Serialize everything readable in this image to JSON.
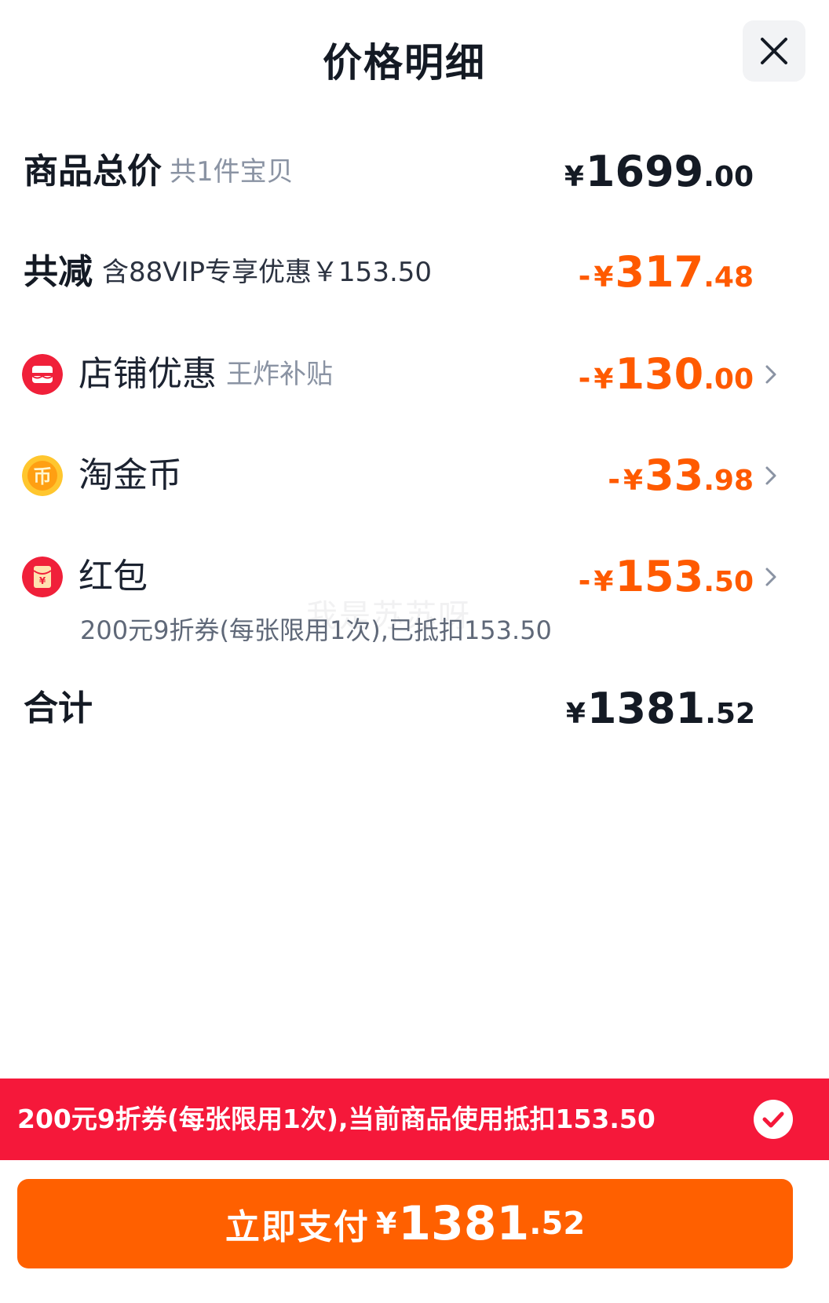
{
  "header": {
    "title": "价格明细",
    "close_icon": "close-icon"
  },
  "rows": {
    "total_goods": {
      "label": "商品总价",
      "sub": "共1件宝贝",
      "currency": "¥",
      "amount_int": "1699",
      "amount_dec": ".00"
    },
    "total_discount": {
      "label": "共减",
      "sub": "含88VIP专享优惠￥153.50",
      "sign": "-",
      "currency": "¥",
      "amount_int": "317",
      "amount_dec": ".48"
    },
    "shop_discount": {
      "icon": "shop-icon",
      "label": "店铺优惠",
      "sub": "王炸补贴",
      "sign": "-",
      "currency": "¥",
      "amount_int": "130",
      "amount_dec": ".00"
    },
    "tao_coin": {
      "icon": "coin-icon",
      "icon_glyph": "币",
      "label": "淘金币",
      "sign": "-",
      "currency": "¥",
      "amount_int": "33",
      "amount_dec": ".98"
    },
    "red_packet": {
      "icon": "red-packet-icon",
      "icon_glyph": "¥",
      "label": "红包",
      "detail": "200元9折券(每张限用1次),已抵扣153.50",
      "sign": "-",
      "currency": "¥",
      "amount_int": "153",
      "amount_dec": ".50"
    },
    "sum": {
      "label": "合计",
      "currency": "¥",
      "amount_int": "1381",
      "amount_dec": ".52"
    }
  },
  "watermark": "我是苏苏呀",
  "coupon_banner": {
    "text": "200元9折券(每张限用1次),当前商品使用抵扣153.50",
    "check_icon": "check-icon",
    "checked": true
  },
  "pay_button": {
    "label": "立即支付",
    "currency": "¥",
    "amount_int": "1381",
    "amount_dec": ".52"
  },
  "colors": {
    "accent_orange": "#ff6000",
    "discount_orange": "#ff5a00",
    "banner_red": "#f5183a",
    "shop_icon_red": "#f0203a",
    "coin_gold": "#ffb21e"
  }
}
